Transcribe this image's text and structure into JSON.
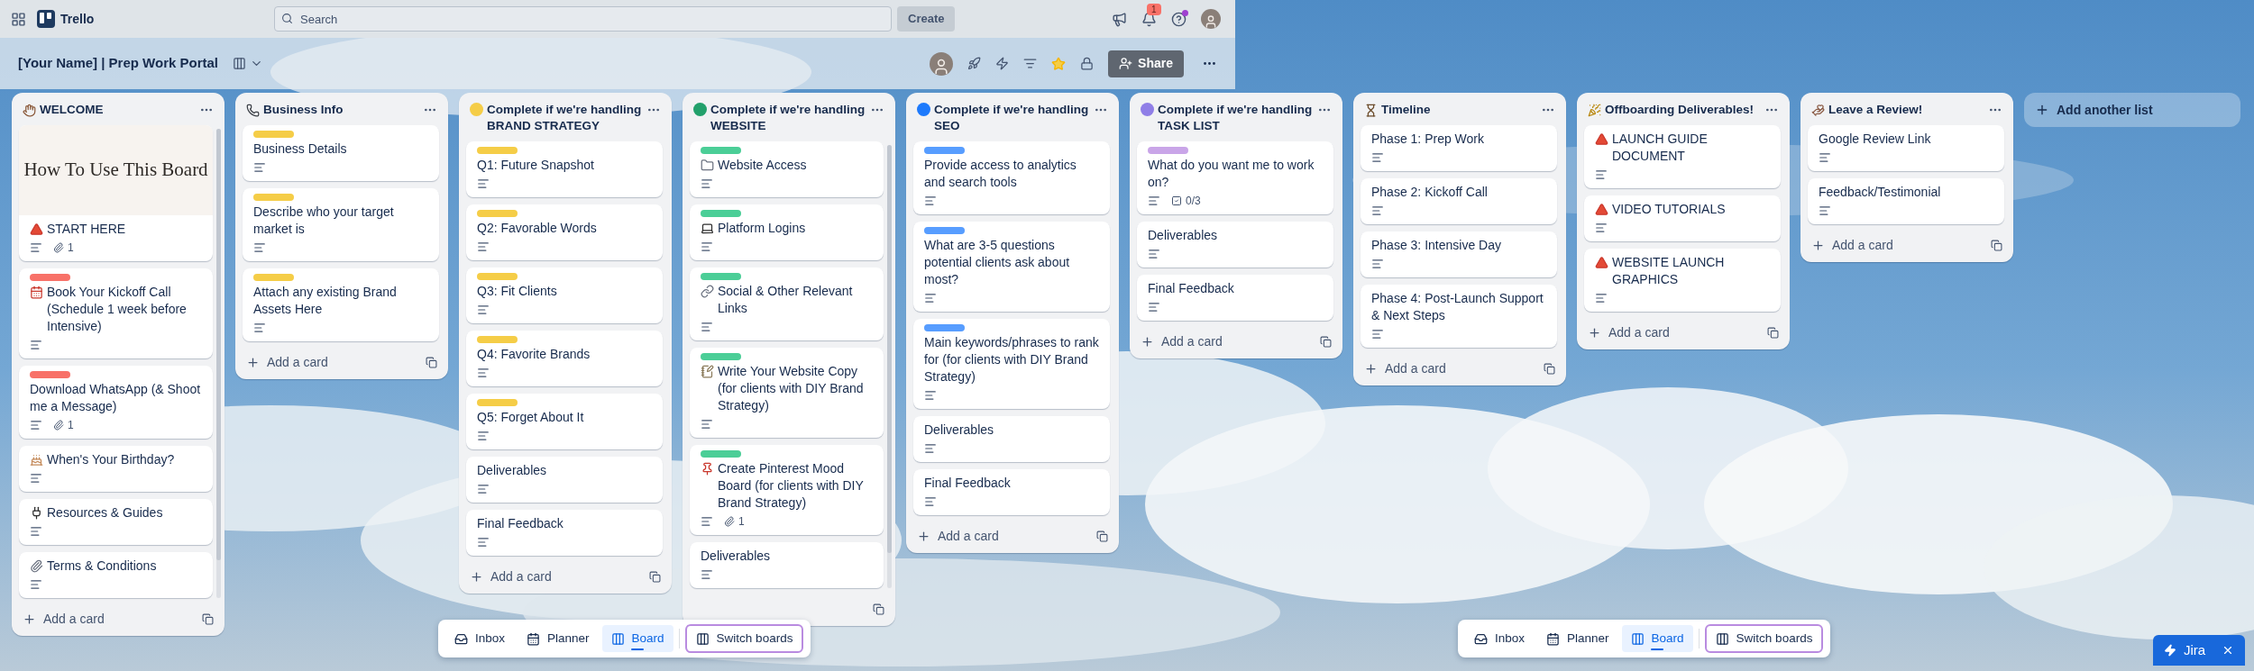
{
  "app": {
    "name": "Trello",
    "search": {
      "placeholder": "Search"
    },
    "create": "Create",
    "notifications": "1",
    "help_unread": true
  },
  "board": {
    "title": "[Your Name] | Prep Work Portal",
    "starred": true,
    "share": "Share"
  },
  "lists": [
    {
      "title": "WELCOME",
      "kind": "hand",
      "scrollable": true,
      "add": "Add a card",
      "cards": [
        {
          "cover": "How To Use This Board",
          "kind": "triangle",
          "title": "START HERE",
          "description": true,
          "attachments": "1"
        },
        {
          "color": "#f87168",
          "kind": "calendar",
          "title": "Book Your Kickoff Call (Schedule 1 week before Intensive)",
          "description": true
        },
        {
          "color": "#f87168",
          "title": "Download WhatsApp (& Shoot me a Message)",
          "description": true,
          "attachments": "1"
        },
        {
          "kind": "cake",
          "title": "When's Your Birthday?",
          "description": true
        },
        {
          "kind": "plug",
          "title": "Resources & Guides",
          "description": true
        },
        {
          "kind": "paperclip",
          "title": "Terms & Conditions",
          "description": true
        }
      ]
    },
    {
      "title": "Business Info",
      "kind": "phone",
      "scrollable": false,
      "add": "Add a card",
      "cards": [
        {
          "color": "#f5cd47",
          "title": "Business Details",
          "description": true
        },
        {
          "color": "#f5cd47",
          "title": "Describe who your target market is",
          "description": true
        },
        {
          "color": "#f5cd47",
          "title": "Attach any existing Brand Assets Here",
          "description": true
        }
      ]
    },
    {
      "title": "Complete if we're handling BRAND STRATEGY",
      "kind": "circle",
      "color": "#f5cd47",
      "scrollable": false,
      "add": "Add a card",
      "cards": [
        {
          "color": "#f5cd47",
          "title": "Q1: Future Snapshot",
          "description": true
        },
        {
          "color": "#f5cd47",
          "title": "Q2: Favorable Words",
          "description": true
        },
        {
          "color": "#f5cd47",
          "title": "Q3: Fit Clients",
          "description": true
        },
        {
          "color": "#f5cd47",
          "title": "Q4: Favorite Brands",
          "description": true
        },
        {
          "color": "#f5cd47",
          "title": "Q5: Forget About It",
          "description": true
        },
        {
          "title": "Deliverables",
          "description": true
        },
        {
          "title": "Final Feedback",
          "description": true
        }
      ]
    },
    {
      "title": "Complete if we're handling WEBSITE",
      "kind": "circle",
      "color": "#22a06b",
      "scrollable": true,
      "cards": [
        {
          "color": "#4bce97",
          "kind": "folder",
          "title": "Website Access",
          "description": true
        },
        {
          "color": "#4bce97",
          "kind": "laptop",
          "title": "Platform Logins",
          "description": true
        },
        {
          "color": "#4bce97",
          "kind": "link",
          "title": "Social & Other Relevant Links",
          "description": true
        },
        {
          "color": "#4bce97",
          "kind": "note",
          "title": "Write Your Website Copy (for clients with DIY Brand Strategy)",
          "description": true
        },
        {
          "color": "#4bce97",
          "kind": "pin",
          "title": "Create Pinterest Mood Board (for clients with DIY Brand Strategy)",
          "description": true,
          "attachments": "1"
        },
        {
          "title": "Deliverables",
          "description": true
        }
      ]
    },
    {
      "title": "Complete if we're handling SEO",
      "kind": "circle",
      "color": "#1d7afc",
      "scrollable": false,
      "add": "Add a card",
      "cards": [
        {
          "color": "#579dff",
          "title": "Provide access to analytics and search tools",
          "description": true
        },
        {
          "color": "#579dff",
          "title": "What are 3-5 questions potential clients ask about most?",
          "description": true
        },
        {
          "color": "#579dff",
          "title": "Main keywords/phrases to rank for (for clients with DIY Brand Strategy)",
          "description": true
        },
        {
          "title": "Deliverables",
          "description": true
        },
        {
          "title": "Final Feedback",
          "description": true
        }
      ]
    },
    {
      "title": "Complete if we're handling TASK LIST",
      "kind": "circle",
      "color": "#8f7ee7",
      "scrollable": false,
      "add": "Add a card",
      "cards": [
        {
          "color": "#c9a5e8",
          "title": "What do you want me to work on?",
          "description": true,
          "checklist": "0/3"
        },
        {
          "title": "Deliverables",
          "description": true
        },
        {
          "title": "Final Feedback",
          "description": true
        }
      ]
    },
    {
      "title": "Timeline",
      "kind": "hourglass",
      "scrollable": false,
      "add": "Add a card",
      "cards": [
        {
          "title": "Phase 1: Prep Work",
          "description": true
        },
        {
          "title": "Phase 2: Kickoff Call",
          "description": true
        },
        {
          "title": "Phase 3: Intensive Day",
          "description": true
        },
        {
          "title": "Phase 4: Post-Launch Support & Next Steps",
          "description": true
        }
      ]
    },
    {
      "title": "Offboarding Deliverables!",
      "kind": "party",
      "scrollable": false,
      "add": "Add a card",
      "cards": [
        {
          "kind": "triangle",
          "title": "LAUNCH GUIDE DOCUMENT",
          "description": true
        },
        {
          "kind": "triangle",
          "title": "VIDEO TUTORIALS",
          "description": true
        },
        {
          "kind": "triangle",
          "title": "WEBSITE LAUNCH GRAPHICS",
          "description": true
        }
      ]
    },
    {
      "title": "Leave a Review!",
      "kind": "pray",
      "scrollable": false,
      "add": "Add a card",
      "cards": [
        {
          "title": "Google Review Link",
          "description": true
        },
        {
          "title": "Feedback/Testimonial",
          "description": true
        }
      ]
    }
  ],
  "add_list": "Add another list",
  "bottom_navs": [
    {
      "items": [
        {
          "label": "Inbox",
          "kind": "inbox",
          "selected": false
        },
        {
          "label": "Planner",
          "kind": "calendar",
          "selected": false
        },
        {
          "label": "Board",
          "kind": "board",
          "selected": true
        }
      ],
      "switch": "Switch boards"
    },
    {
      "items": [
        {
          "label": "Inbox",
          "kind": "inbox",
          "selected": false
        },
        {
          "label": "Planner",
          "kind": "calendar",
          "selected": false
        },
        {
          "label": "Board",
          "kind": "board",
          "selected": true
        }
      ],
      "switch": "Switch boards"
    }
  ],
  "jira": {
    "label": "Jira"
  }
}
